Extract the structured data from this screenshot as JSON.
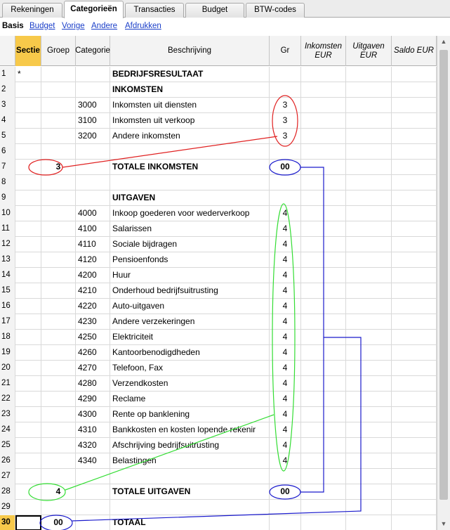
{
  "tabs": [
    {
      "label": "Rekeningen"
    },
    {
      "label": "Categorieën"
    },
    {
      "label": "Transacties"
    },
    {
      "label": "Budget"
    },
    {
      "label": "BTW-codes"
    }
  ],
  "views": [
    {
      "label": "Basis"
    },
    {
      "label": "Budget"
    },
    {
      "label": "Vorige"
    },
    {
      "label": "Andere"
    },
    {
      "label": "Afdrukken"
    }
  ],
  "columns": [
    {
      "label": ""
    },
    {
      "label": "Sectie"
    },
    {
      "label": "Groep"
    },
    {
      "label": "Categorie"
    },
    {
      "label": "Beschrijving"
    },
    {
      "label": "Gr"
    },
    {
      "label": "Inkomsten EUR"
    },
    {
      "label": "Uitgaven EUR"
    },
    {
      "label": "Saldo EUR"
    }
  ],
  "rows": [
    {
      "n": "1",
      "sectie": "*",
      "groep": "",
      "cat": "",
      "desc": "BEDRIJFSRESULTAAT",
      "gr": "",
      "bold": true
    },
    {
      "n": "2",
      "sectie": "",
      "groep": "",
      "cat": "",
      "desc": "INKOMSTEN",
      "gr": "",
      "bold": true
    },
    {
      "n": "3",
      "sectie": "",
      "groep": "",
      "cat": "3000",
      "desc": "Inkomsten uit diensten",
      "gr": "3"
    },
    {
      "n": "4",
      "sectie": "",
      "groep": "",
      "cat": "3100",
      "desc": "Inkomsten uit verkoop",
      "gr": "3"
    },
    {
      "n": "5",
      "sectie": "",
      "groep": "",
      "cat": "3200",
      "desc": "Andere inkomsten",
      "gr": "3"
    },
    {
      "n": "6",
      "sectie": "",
      "groep": "",
      "cat": "",
      "desc": "",
      "gr": ""
    },
    {
      "n": "7",
      "sectie": "",
      "groep": "3",
      "cat": "",
      "desc": "TOTALE INKOMSTEN",
      "gr": "00",
      "bold": true
    },
    {
      "n": "8",
      "sectie": "",
      "groep": "",
      "cat": "",
      "desc": "",
      "gr": ""
    },
    {
      "n": "9",
      "sectie": "",
      "groep": "",
      "cat": "",
      "desc": "UITGAVEN",
      "gr": "",
      "bold": true
    },
    {
      "n": "10",
      "sectie": "",
      "groep": "",
      "cat": "4000",
      "desc": "Inkoop goederen voor wederverkoop",
      "gr": "4"
    },
    {
      "n": "11",
      "sectie": "",
      "groep": "",
      "cat": "4100",
      "desc": "Salarissen",
      "gr": "4"
    },
    {
      "n": "12",
      "sectie": "",
      "groep": "",
      "cat": "4110",
      "desc": "Sociale bijdragen",
      "gr": "4"
    },
    {
      "n": "13",
      "sectie": "",
      "groep": "",
      "cat": "4120",
      "desc": "Pensioenfonds",
      "gr": "4"
    },
    {
      "n": "14",
      "sectie": "",
      "groep": "",
      "cat": "4200",
      "desc": "Huur",
      "gr": "4"
    },
    {
      "n": "15",
      "sectie": "",
      "groep": "",
      "cat": "4210",
      "desc": "Onderhoud bedrijfsuitrusting",
      "gr": "4"
    },
    {
      "n": "16",
      "sectie": "",
      "groep": "",
      "cat": "4220",
      "desc": "Auto-uitgaven",
      "gr": "4"
    },
    {
      "n": "17",
      "sectie": "",
      "groep": "",
      "cat": "4230",
      "desc": "Andere verzekeringen",
      "gr": "4"
    },
    {
      "n": "18",
      "sectie": "",
      "groep": "",
      "cat": "4250",
      "desc": "Elektriciteit",
      "gr": "4"
    },
    {
      "n": "19",
      "sectie": "",
      "groep": "",
      "cat": "4260",
      "desc": "Kantoorbenodigdheden",
      "gr": "4"
    },
    {
      "n": "20",
      "sectie": "",
      "groep": "",
      "cat": "4270",
      "desc": "Telefoon, Fax",
      "gr": "4"
    },
    {
      "n": "21",
      "sectie": "",
      "groep": "",
      "cat": "4280",
      "desc": "Verzendkosten",
      "gr": "4"
    },
    {
      "n": "22",
      "sectie": "",
      "groep": "",
      "cat": "4290",
      "desc": "Reclame",
      "gr": "4"
    },
    {
      "n": "23",
      "sectie": "",
      "groep": "",
      "cat": "4300",
      "desc": "Rente op banklening",
      "gr": "4"
    },
    {
      "n": "24",
      "sectie": "",
      "groep": "",
      "cat": "4310",
      "desc": "Bankkosten en kosten lopende rekenir",
      "gr": "4"
    },
    {
      "n": "25",
      "sectie": "",
      "groep": "",
      "cat": "4320",
      "desc": "Afschrijving bedrijfsuitrusting",
      "gr": "4"
    },
    {
      "n": "26",
      "sectie": "",
      "groep": "",
      "cat": "4340",
      "desc": "Belastingen",
      "gr": "4"
    },
    {
      "n": "27",
      "sectie": "",
      "groep": "",
      "cat": "",
      "desc": "",
      "gr": ""
    },
    {
      "n": "28",
      "sectie": "",
      "groep": "4",
      "cat": "",
      "desc": "TOTALE UITGAVEN",
      "gr": "00",
      "bold": true
    },
    {
      "n": "29",
      "sectie": "",
      "groep": "",
      "cat": "",
      "desc": "",
      "gr": ""
    },
    {
      "n": "30",
      "sectie": "",
      "groep": "00",
      "cat": "",
      "desc": "TOTAAL",
      "gr": "",
      "bold": true,
      "selected": true
    }
  ],
  "annotation_colors": {
    "income_group": "#e02020",
    "expense_group": "#33dd33",
    "totals": "#1a1acc"
  }
}
